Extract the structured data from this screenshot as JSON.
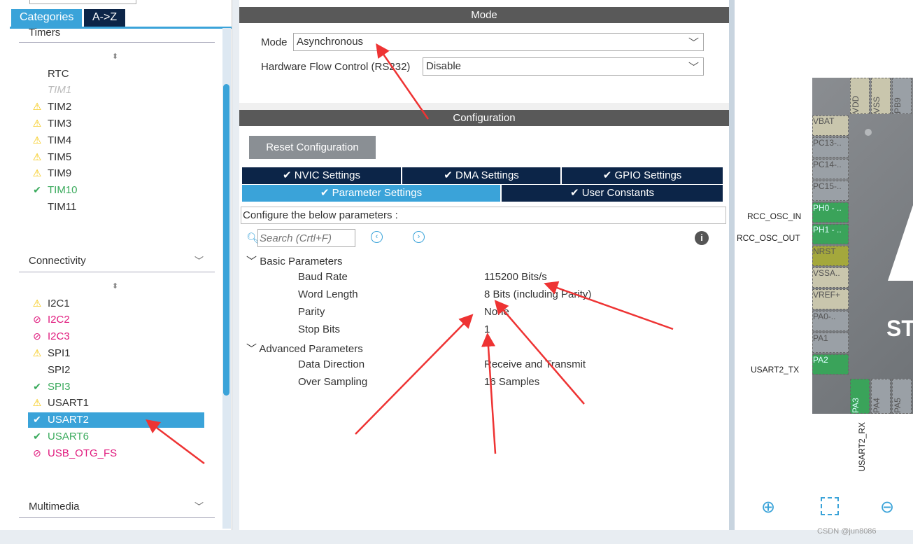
{
  "left": {
    "tabs": [
      "Categories",
      "A->Z"
    ],
    "timers_header": "Timers",
    "timers": [
      {
        "label": "RTC",
        "status": "none"
      },
      {
        "label": "TIM1",
        "status": "disabled"
      },
      {
        "label": "TIM2",
        "status": "warning"
      },
      {
        "label": "TIM3",
        "status": "warning"
      },
      {
        "label": "TIM4",
        "status": "warning"
      },
      {
        "label": "TIM5",
        "status": "warning"
      },
      {
        "label": "TIM9",
        "status": "warning"
      },
      {
        "label": "TIM10",
        "status": "ok"
      },
      {
        "label": "TIM11",
        "status": "none"
      }
    ],
    "connectivity_header": "Connectivity",
    "connectivity": [
      {
        "label": "I2C1",
        "status": "warning"
      },
      {
        "label": "I2C2",
        "status": "blocked"
      },
      {
        "label": "I2C3",
        "status": "blocked"
      },
      {
        "label": "SPI1",
        "status": "warning"
      },
      {
        "label": "SPI2",
        "status": "none"
      },
      {
        "label": "SPI3",
        "status": "ok"
      },
      {
        "label": "USART1",
        "status": "warning"
      },
      {
        "label": "USART2",
        "status": "selected"
      },
      {
        "label": "USART6",
        "status": "ok"
      },
      {
        "label": "USB_OTG_FS",
        "status": "blocked"
      }
    ],
    "multimedia_header": "Multimedia"
  },
  "mode": {
    "title": "Mode",
    "mode_label": "Mode",
    "mode_value": "Asynchronous",
    "flow_label": "Hardware Flow Control (RS232)",
    "flow_value": "Disable"
  },
  "config": {
    "title": "Configuration",
    "reset": "Reset Configuration",
    "tabs_row1": [
      "NVIC Settings",
      "DMA Settings",
      "GPIO Settings"
    ],
    "tabs_row2": [
      "Parameter Settings",
      "User Constants"
    ],
    "hint": "Configure the below parameters :",
    "search_placeholder": "Search (Crtl+F)",
    "basic": "Basic Parameters",
    "advanced": "Advanced Parameters",
    "params": [
      {
        "name": "Baud Rate",
        "value": "115200 Bits/s"
      },
      {
        "name": "Word Length",
        "value": "8 Bits (including Parity)"
      },
      {
        "name": "Parity",
        "value": "None"
      },
      {
        "name": "Stop Bits",
        "value": "1"
      }
    ],
    "adv_params": [
      {
        "name": "Data Direction",
        "value": "Receive and Transmit"
      },
      {
        "name": "Over Sampling",
        "value": "16 Samples"
      }
    ]
  },
  "chip": {
    "top_pins": [
      "VDD",
      "VSS",
      "PB9"
    ],
    "left_pins": [
      "VBAT",
      "PC13-..",
      "PC14-..",
      "PC15-..",
      "PH0 - ..",
      "PH1 - ..",
      "NRST",
      "VSSA..",
      "VREF+",
      "PA0-..",
      "PA1",
      "PA2"
    ],
    "bottom_pins": [
      "PA3",
      "PA4",
      "PA5"
    ],
    "labels": {
      "ph0": "RCC_OSC_IN",
      "ph1": "RCC_OSC_OUT",
      "pa2": "USART2_TX",
      "pa3": "USART2_RX"
    },
    "logo": "ST"
  },
  "watermark": "CSDN @jun8086",
  "colors": {
    "accent": "#3aa3d9",
    "navy": "#0c2548",
    "warning": "#f5c400",
    "ok": "#3aaa5c",
    "blocked": "#e0197d",
    "pin_green": "#3aa35a"
  }
}
